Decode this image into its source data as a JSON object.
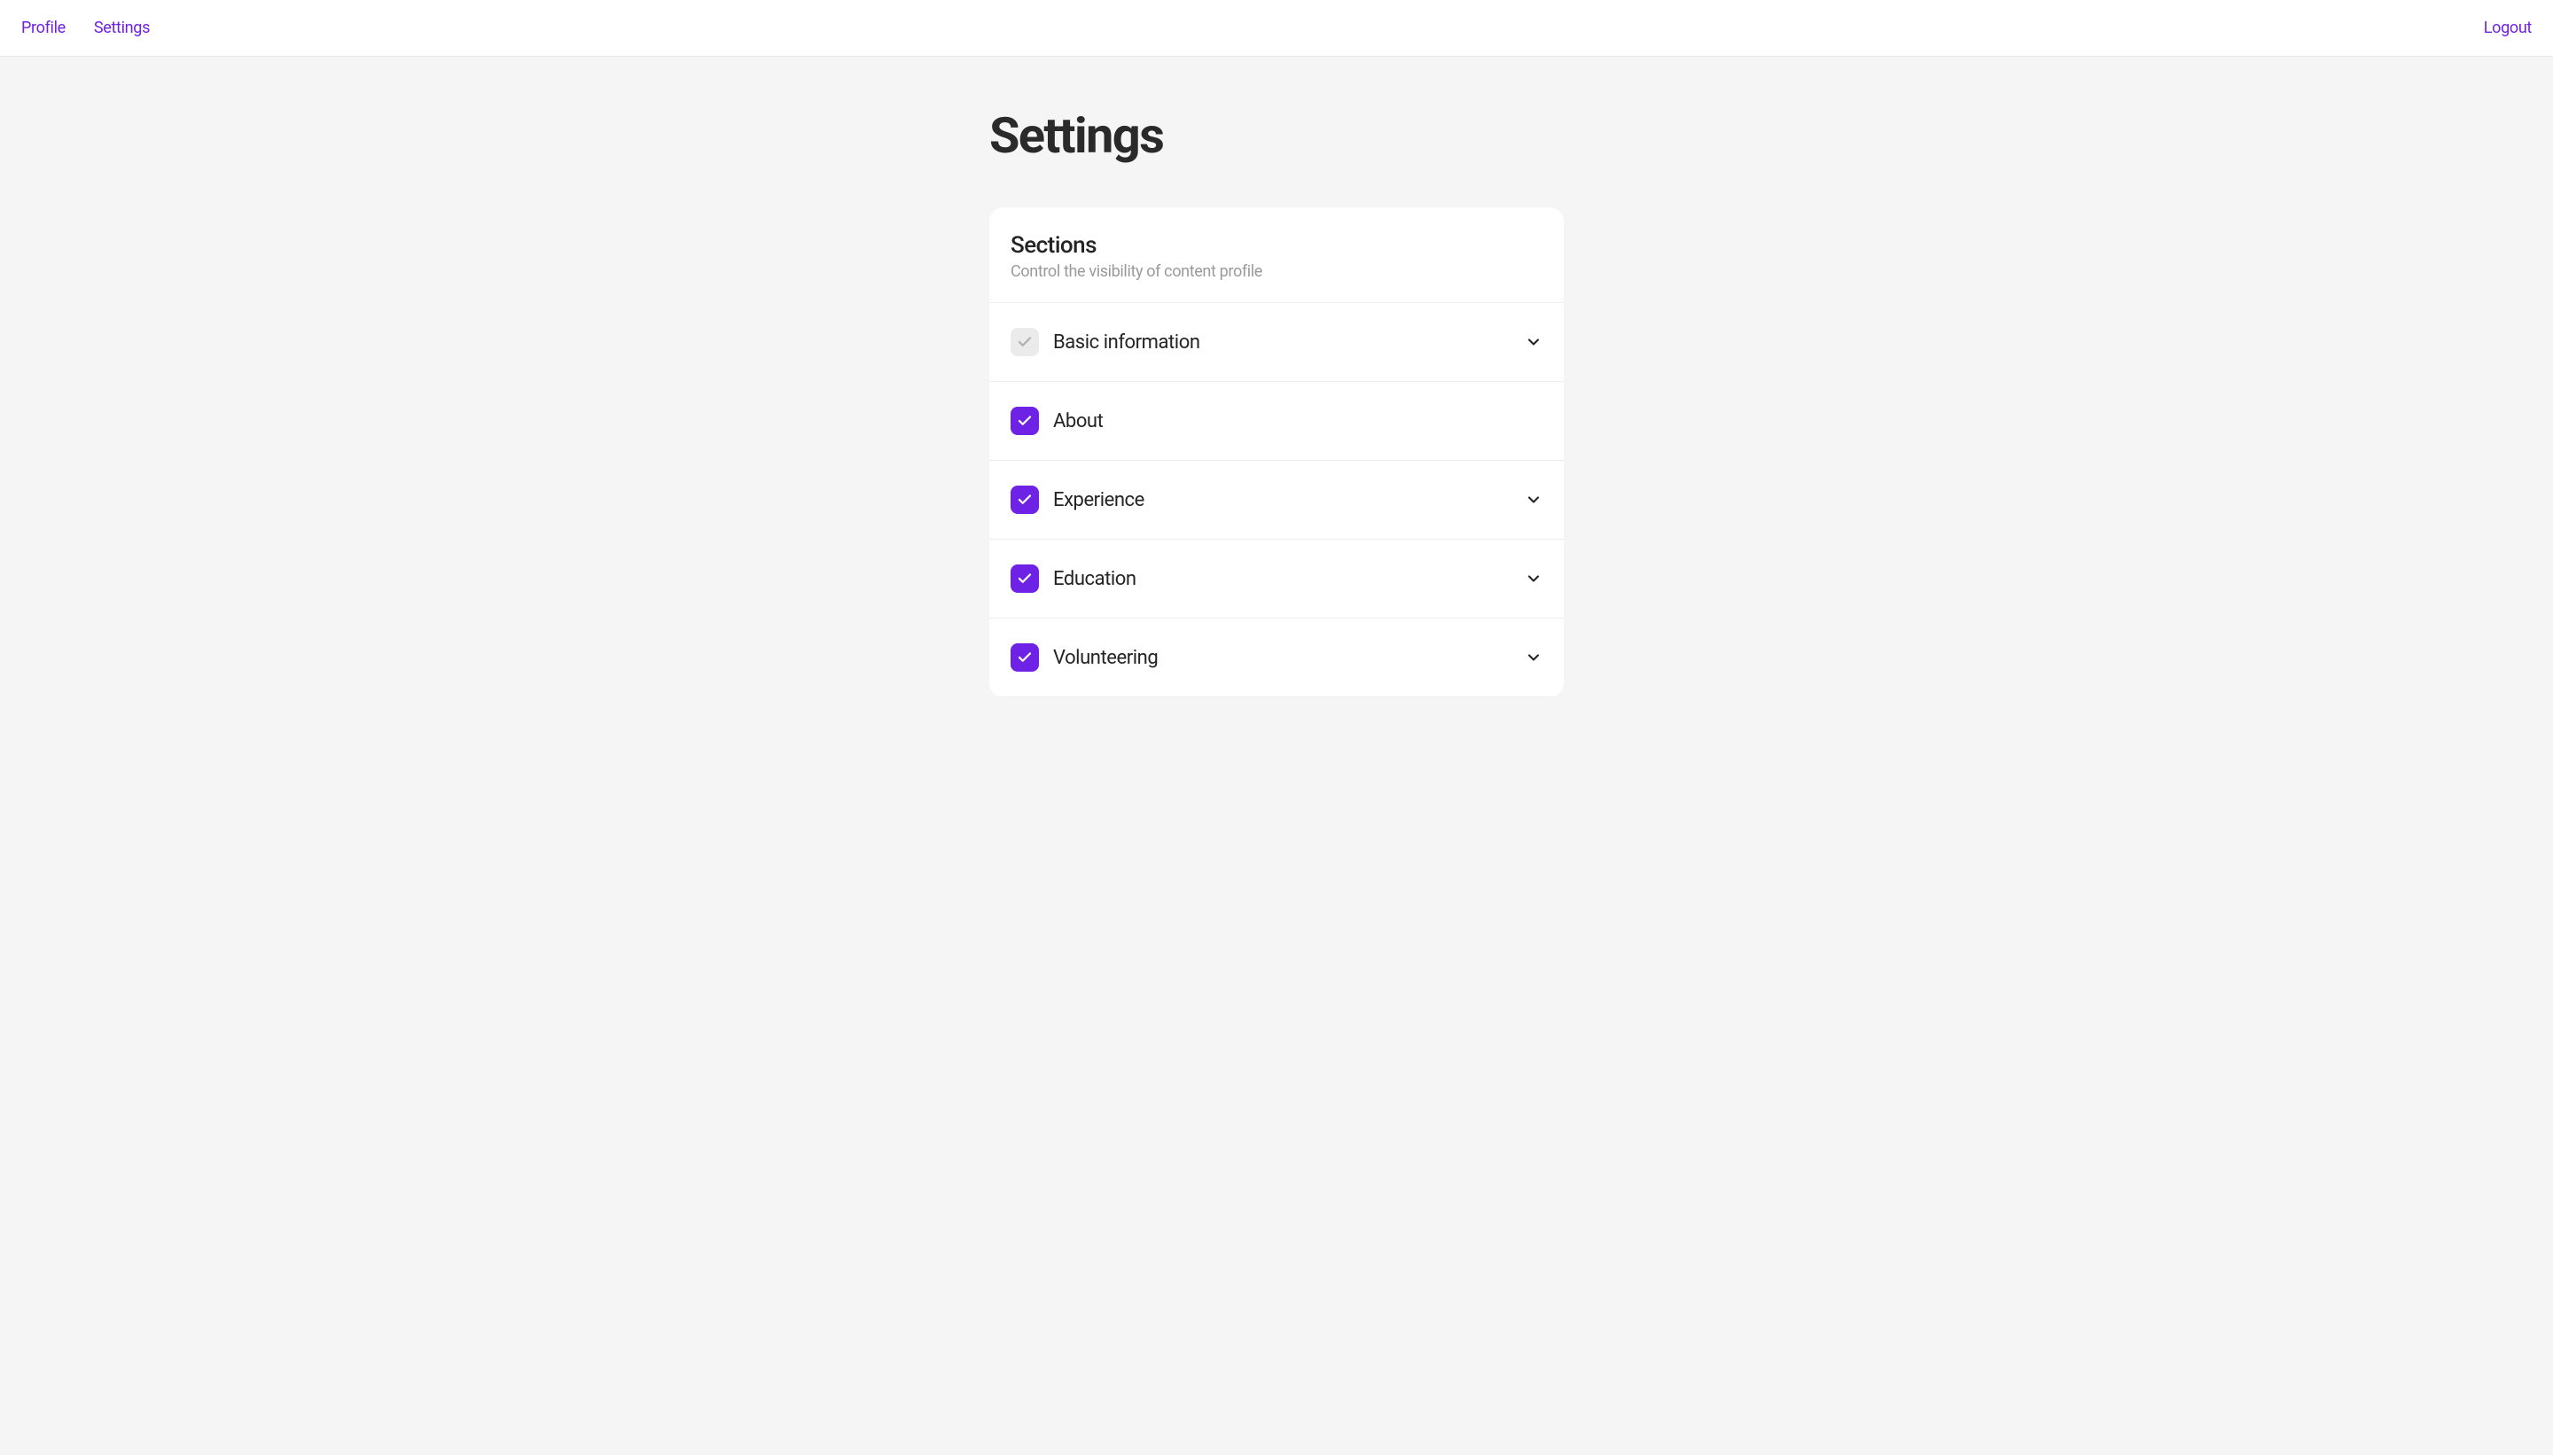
{
  "nav": {
    "left": [
      {
        "label": "Profile"
      },
      {
        "label": "Settings"
      }
    ],
    "logout": "Logout"
  },
  "page_title": "Settings",
  "card": {
    "title": "Sections",
    "subtitle": "Control the visibility of content profile"
  },
  "sections": [
    {
      "label": "Basic information",
      "checked": true,
      "disabled": true,
      "expandable": true
    },
    {
      "label": "About",
      "checked": true,
      "disabled": false,
      "expandable": false
    },
    {
      "label": "Experience",
      "checked": true,
      "disabled": false,
      "expandable": true
    },
    {
      "label": "Education",
      "checked": true,
      "disabled": false,
      "expandable": true
    },
    {
      "label": "Volunteering",
      "checked": true,
      "disabled": false,
      "expandable": true
    }
  ],
  "colors": {
    "accent": "#6E22E6",
    "bg": "#f5f5f5",
    "card": "#ffffff"
  }
}
